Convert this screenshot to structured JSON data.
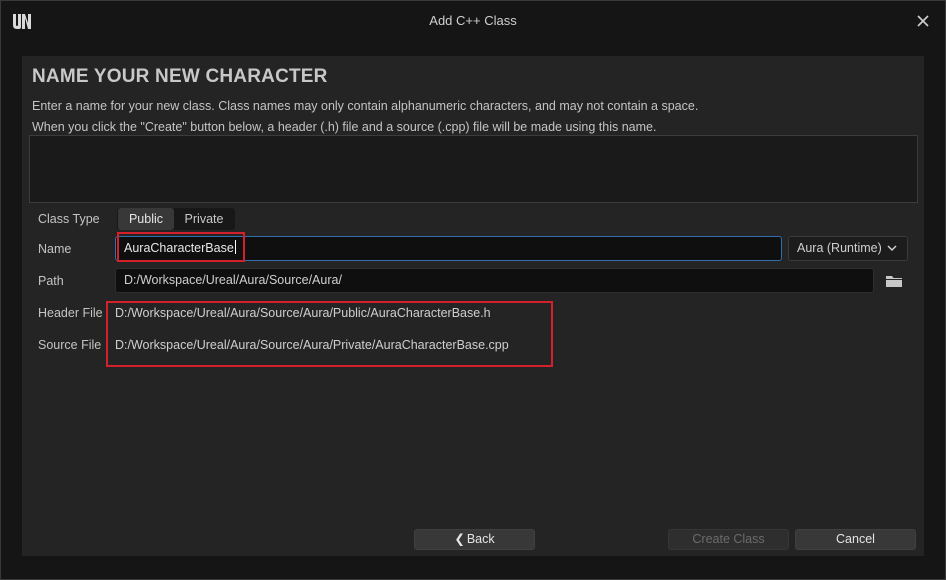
{
  "window": {
    "title": "Add C++ Class"
  },
  "page": {
    "heading": "NAME YOUR NEW CHARACTER",
    "description_line1": "Enter a name for your new class. Class names may only contain alphanumeric characters, and may not contain a space.",
    "description_line2": "When you click the \"Create\" button below, a header (.h) file and a source (.cpp) file will be made using this name."
  },
  "form": {
    "class_type_label": "Class Type",
    "class_type_options": [
      "Public",
      "Private"
    ],
    "class_type_selected": "Public",
    "name_label": "Name",
    "name_value": "AuraCharacterBase",
    "module_value": "Aura (Runtime)",
    "path_label": "Path",
    "path_value": "D:/Workspace/Ureal/Aura/Source/Aura/",
    "header_label": "Header File",
    "header_value": "D:/Workspace/Ureal/Aura/Source/Aura/Public/AuraCharacterBase.h",
    "source_label": "Source File",
    "source_value": "D:/Workspace/Ureal/Aura/Source/Aura/Private/AuraCharacterBase.cpp"
  },
  "buttons": {
    "back": "Back",
    "create": "Create Class",
    "cancel": "Cancel"
  },
  "icons": {
    "logo": "unreal-logo-icon",
    "close": "close-icon",
    "folder": "folder-icon",
    "dropdown": "chevron-down-icon",
    "back": "chevron-left-icon"
  },
  "colors": {
    "highlight_box": "#d3202a",
    "focus_border": "#2f6fb0",
    "panel_bg": "#242424"
  }
}
